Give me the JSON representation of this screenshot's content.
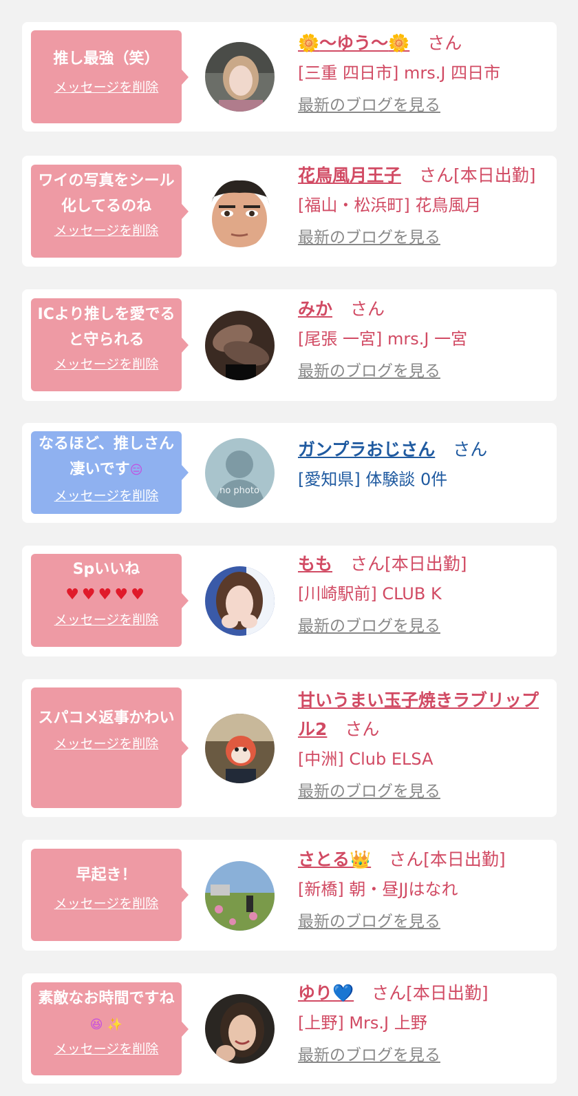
{
  "common": {
    "delete_label": "メッセージを削除",
    "blog_label": "最新のブログを見る",
    "san": "さん"
  },
  "colors": {
    "background": "#f2f2f2",
    "bubble_pink": "#ee9aa4",
    "bubble_blue": "#8fb1f0",
    "name_pink": "#d14a63",
    "name_blue": "#1f5aa0",
    "blog_gray": "#888888"
  },
  "items": [
    {
      "message": "推し最強（笑）",
      "bubble": "pink",
      "name_prefix": "🌼",
      "name": "〜ゆう〜",
      "name_suffix": "🌼",
      "san_text": "さん",
      "shop": "[三重 四日市] mrs.J 四日市",
      "blog": "最新のブログを見る",
      "avatar": "avatar-woman-car"
    },
    {
      "message": "ワイの写真をシール化してるのね",
      "bubble": "pink",
      "name_prefix": "",
      "name": "花鳥風月王子",
      "name_suffix": "",
      "san_text": "さん[本日出勤]",
      "shop": "[福山・松浜町] 花鳥風月",
      "blog": "最新のブログを見る",
      "avatar": "avatar-man-face"
    },
    {
      "message": "ICより推しを愛でると守られる",
      "bubble": "pink",
      "name_prefix": "",
      "name": "みか",
      "name_suffix": "",
      "san_text": "さん",
      "shop": "[尾張 一宮] mrs.J 一宮",
      "blog": "最新のブログを見る",
      "avatar": "avatar-legs"
    },
    {
      "message": "なるほど、推しさん凄いです",
      "message_suffix": "😑",
      "bubble": "blue",
      "name_prefix": "",
      "name": "ガンプラおじさん",
      "name_suffix": "",
      "san_text": "さん",
      "shop": "[愛知県] 体験談 0件",
      "blog": "",
      "avatar_text": "no photo",
      "avatar": "avatar-no-photo"
    },
    {
      "message": "Spいいね",
      "message_line2": "♥♥♥♥♥",
      "bubble": "pink",
      "name_prefix": "",
      "name": "もも",
      "name_suffix": "",
      "san_text": "さん[本日出勤]",
      "shop": "[川崎駅前] CLUB K",
      "blog": "最新のブログを見る",
      "avatar": "avatar-woman-hands"
    },
    {
      "message": "スパコメ返事かわい",
      "bubble": "pink",
      "name_prefix": "",
      "name": "甘いうまい玉子焼きラブリップル2",
      "name_suffix": "",
      "san_text": "さん",
      "shop": "[中洲] Club ELSA",
      "blog": "最新のブログを見る",
      "avatar": "avatar-mask"
    },
    {
      "message": "早起き！",
      "bubble": "pink",
      "name_prefix": "",
      "name": "さとる",
      "name_suffix": "👑",
      "san_text": "さん[本日出勤]",
      "shop": "[新橋] 朝・昼JJはなれ",
      "blog": "最新のブログを見る",
      "avatar": "avatar-field"
    },
    {
      "message": "素敵なお時間ですね",
      "message_suffix": "😆 ✨",
      "bubble": "pink",
      "name_prefix": "",
      "name": "ゆり",
      "name_suffix": "💙",
      "san_text": "さん[本日出勤]",
      "shop": "[上野] Mrs.J 上野",
      "blog": "最新のブログを見る",
      "avatar": "avatar-woman-smile"
    }
  ]
}
